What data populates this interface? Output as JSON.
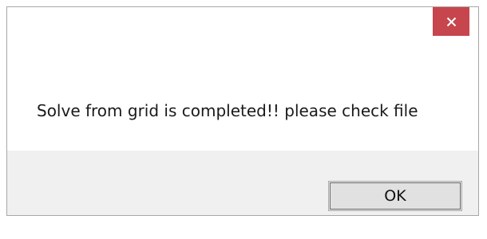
{
  "dialog": {
    "message": "Solve from grid is completed!! please check file",
    "ok_label": "OK",
    "close_icon": "close-icon"
  },
  "colors": {
    "close_button_bg": "#c7454c",
    "content_bg": "#ffffff",
    "footer_bg": "#f0f0f0",
    "button_bg": "#e1e1e1"
  }
}
